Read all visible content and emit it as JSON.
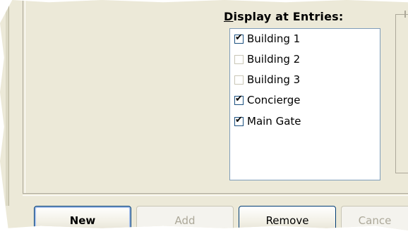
{
  "entries_panel": {
    "label": "Display at Entries:",
    "label_underlined_char": "D",
    "label_rest": "isplay at Entries:",
    "items": [
      {
        "label": "Building 1",
        "checked": true
      },
      {
        "label": "Building 2",
        "checked": false
      },
      {
        "label": "Building 3",
        "checked": false
      },
      {
        "label": "Concierge",
        "checked": true
      },
      {
        "label": "Main Gate",
        "checked": true
      }
    ]
  },
  "buttons": {
    "new_label": "New",
    "add_label": "Add",
    "remove_label": "Remove",
    "cancel_label": "Cance"
  },
  "colors": {
    "window_bg": "#ece9d8",
    "listbox_border": "#7f9db9",
    "button_border": "#003c74",
    "disabled_text": "#aca899"
  }
}
